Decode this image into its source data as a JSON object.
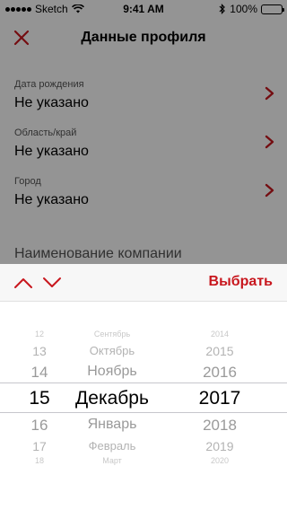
{
  "status_bar": {
    "carrier": "Sketch",
    "time": "9:41 AM",
    "battery": "100%",
    "battery_level": 1.0
  },
  "nav": {
    "title": "Данные профиля"
  },
  "form": {
    "fields": [
      {
        "label": "Дата рождения",
        "value": "Не указано"
      },
      {
        "label": "Область/край",
        "value": "Не указано"
      },
      {
        "label": "Город",
        "value": "Не указано"
      }
    ],
    "company_label": "Наименование компании"
  },
  "toolbar": {
    "select_label": "Выбрать"
  },
  "picker": {
    "days": [
      "12",
      "13",
      "14",
      "15",
      "16",
      "17",
      "18"
    ],
    "months": [
      "Сентябрь",
      "Октябрь",
      "Ноябрь",
      "Декабрь",
      "Январь",
      "Февраль",
      "Март"
    ],
    "years": [
      "2014",
      "2015",
      "2016",
      "2017",
      "2018",
      "2019",
      "2020"
    ],
    "selected": {
      "day": "15",
      "month": "Декабрь",
      "year": "2017"
    }
  },
  "colors": {
    "accent": "#c8171e",
    "overlay": "#6b6b6b"
  }
}
